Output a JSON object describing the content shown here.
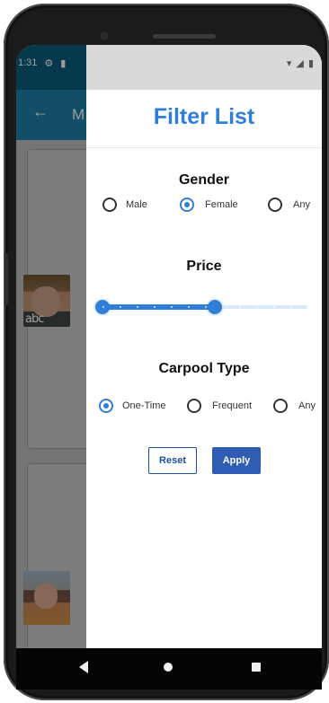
{
  "status_bar": {
    "time": "1:31",
    "left_icons": [
      "settings-icon",
      "sim-icon"
    ],
    "right_icons": [
      "wifi-icon",
      "signal-icon",
      "battery-icon"
    ]
  },
  "background_app": {
    "title_partial": "M",
    "back_icon": "back-arrow-icon",
    "avatar_tag": "abc"
  },
  "filter": {
    "title": "Filter List",
    "gender": {
      "label": "Gender",
      "options": [
        "Male",
        "Female",
        "Any"
      ],
      "selected": "Female"
    },
    "price": {
      "label": "Price",
      "range": [
        0,
        0.55
      ]
    },
    "carpool": {
      "label": "Carpool Type",
      "options": [
        "One-Time",
        "Frequent",
        "Any"
      ],
      "selected": "One-Time"
    },
    "buttons": {
      "reset": "Reset",
      "apply": "Apply"
    }
  },
  "colors": {
    "accent": "#2f7ed8",
    "button_primary": "#2f5db4",
    "app_bar": "#1d7ea5",
    "status_bar_dark": "#0b5d7a"
  }
}
